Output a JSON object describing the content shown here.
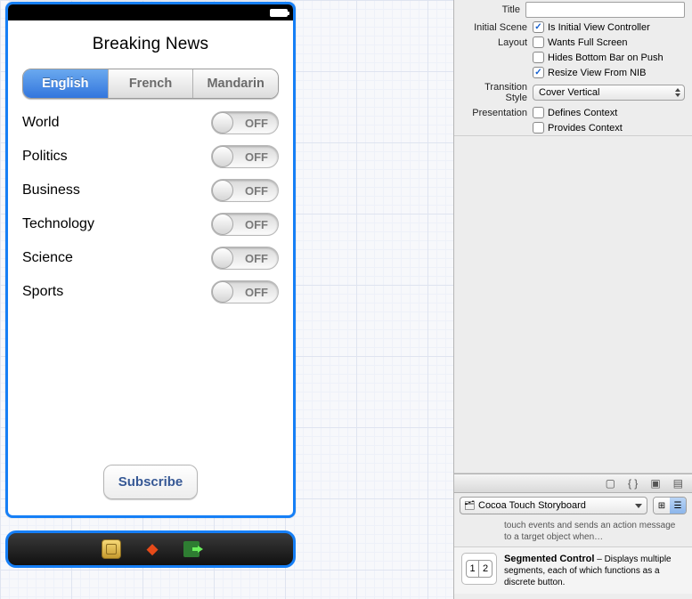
{
  "app": {
    "title": "Breaking News",
    "segments": [
      "English",
      "French",
      "Mandarin"
    ],
    "selected_segment": 0,
    "categories": [
      {
        "label": "World",
        "on": false
      },
      {
        "label": "Politics",
        "on": false
      },
      {
        "label": "Business",
        "on": false
      },
      {
        "label": "Technology",
        "on": false
      },
      {
        "label": "Science",
        "on": false
      },
      {
        "label": "Sports",
        "on": false
      }
    ],
    "switch_off_text": "OFF",
    "subscribe_label": "Subscribe"
  },
  "inspector": {
    "title_label": "Title",
    "title_value": "",
    "initial_scene_label": "Initial Scene",
    "is_initial_vc": {
      "label": "Is Initial View Controller",
      "checked": true
    },
    "layout_label": "Layout",
    "wants_full_screen": {
      "label": "Wants Full Screen",
      "checked": false
    },
    "hides_bottom_bar": {
      "label": "Hides Bottom Bar on Push",
      "checked": false
    },
    "resize_from_nib": {
      "label": "Resize View From NIB",
      "checked": true
    },
    "transition_label": "Transition Style",
    "transition_value": "Cover Vertical",
    "presentation_label": "Presentation",
    "defines_context": {
      "label": "Defines Context",
      "checked": false
    },
    "provides_context": {
      "label": "Provides Context",
      "checked": false
    }
  },
  "library": {
    "filter": "Cocoa Touch Storyboard",
    "partial_top": "touch events and sends an action message to a target object when…",
    "item": {
      "name": "Segmented Control",
      "desc": "Displays multiple segments, each of which functions as a discrete button."
    }
  }
}
